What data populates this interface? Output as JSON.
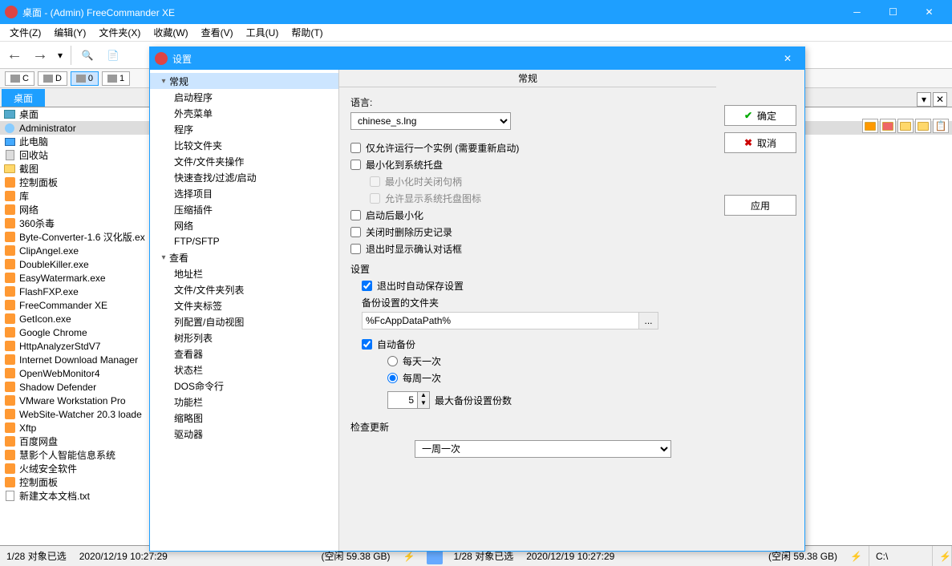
{
  "window": {
    "title": "桌面 - (Admin) FreeCommander XE"
  },
  "menu": [
    "文件(Z)",
    "编辑(Y)",
    "文件夹(X)",
    "收藏(W)",
    "查看(V)",
    "工具(U)",
    "帮助(T)"
  ],
  "drives": [
    {
      "label": "C"
    },
    {
      "label": "D"
    },
    {
      "label": "0",
      "active": true
    },
    {
      "label": "1"
    }
  ],
  "tab": {
    "label": "桌面"
  },
  "files": [
    {
      "name": "桌面",
      "icon": "desktop"
    },
    {
      "name": "Administrator",
      "icon": "user",
      "selected": true
    },
    {
      "name": "此电脑",
      "icon": "pc"
    },
    {
      "name": "回收站",
      "icon": "recycle"
    },
    {
      "name": "截图",
      "icon": "folder"
    },
    {
      "name": "控制面板",
      "icon": "control"
    },
    {
      "name": "库",
      "icon": "library"
    },
    {
      "name": "网络",
      "icon": "network"
    },
    {
      "name": "360杀毒",
      "icon": "app"
    },
    {
      "name": "Byte-Converter-1.6 汉化版.ex",
      "icon": "app"
    },
    {
      "name": "ClipAngel.exe",
      "icon": "app"
    },
    {
      "name": "DoubleKiller.exe",
      "icon": "app"
    },
    {
      "name": "EasyWatermark.exe",
      "icon": "app"
    },
    {
      "name": "FlashFXP.exe",
      "icon": "app"
    },
    {
      "name": "FreeCommander XE",
      "icon": "app"
    },
    {
      "name": "GetIcon.exe",
      "icon": "app"
    },
    {
      "name": "Google Chrome",
      "icon": "chrome"
    },
    {
      "name": "HttpAnalyzerStdV7",
      "icon": "app"
    },
    {
      "name": "Internet Download Manager",
      "icon": "app"
    },
    {
      "name": "OpenWebMonitor4",
      "icon": "app"
    },
    {
      "name": "Shadow Defender",
      "icon": "app"
    },
    {
      "name": "VMware Workstation Pro",
      "icon": "app"
    },
    {
      "name": "WebSite-Watcher 20.3 loade",
      "icon": "app"
    },
    {
      "name": "Xftp",
      "icon": "app"
    },
    {
      "name": "百度网盘",
      "icon": "app"
    },
    {
      "name": "慧影个人智能信息系统",
      "icon": "app"
    },
    {
      "name": "火绒安全软件",
      "icon": "app"
    },
    {
      "name": "控制面板",
      "icon": "control"
    },
    {
      "name": "新建文本文档.txt",
      "icon": "txt"
    }
  ],
  "status": {
    "left": {
      "selection": "1/28 对象已选",
      "date": "2020/12/19 10:27:29",
      "free": "(空闲 59.38 GB)"
    },
    "right": {
      "selection": "1/28 对象已选",
      "date": "2020/12/19 10:27:29",
      "free": "(空闲 59.38 GB)"
    },
    "path": "C:\\"
  },
  "dialog": {
    "title": "设置",
    "tree": [
      {
        "label": "常规",
        "level": 0,
        "expanded": true,
        "selected": true
      },
      {
        "label": "启动程序",
        "level": 1
      },
      {
        "label": "外壳菜单",
        "level": 1
      },
      {
        "label": "程序",
        "level": 1
      },
      {
        "label": "比较文件夹",
        "level": 1
      },
      {
        "label": "文件/文件夹操作",
        "level": 1
      },
      {
        "label": "快速查找/过滤/启动",
        "level": 1
      },
      {
        "label": "选择项目",
        "level": 1
      },
      {
        "label": "压缩插件",
        "level": 1
      },
      {
        "label": "网络",
        "level": 1
      },
      {
        "label": "FTP/SFTP",
        "level": 1
      },
      {
        "label": "查看",
        "level": 0,
        "expanded": true
      },
      {
        "label": "地址栏",
        "level": 1
      },
      {
        "label": "文件/文件夹列表",
        "level": 1
      },
      {
        "label": "文件夹标签",
        "level": 1
      },
      {
        "label": "列配置/自动视图",
        "level": 1
      },
      {
        "label": "树形列表",
        "level": 1
      },
      {
        "label": "查看器",
        "level": 1
      },
      {
        "label": "状态栏",
        "level": 1
      },
      {
        "label": "DOS命令行",
        "level": 1
      },
      {
        "label": "功能栏",
        "level": 1
      },
      {
        "label": "缩略图",
        "level": 1
      },
      {
        "label": "驱动器",
        "level": 1
      }
    ],
    "content": {
      "header": "常规",
      "language_label": "语言:",
      "language_value": "chinese_s.lng",
      "chk_single_instance": "仅允许运行一个实例 (需要重新启动)",
      "chk_minimize_tray": "最小化到系统托盘",
      "chk_close_handle": "最小化时关闭句柄",
      "chk_allow_tray_icon": "允许显示系统托盘图标",
      "chk_start_minimized": "启动后最小化",
      "chk_clear_history": "关闭时删除历史记录",
      "chk_confirm_exit": "退出时显示确认对话框",
      "section_settings": "设置",
      "chk_autosave": "退出时自动保存设置",
      "backup_folder_label": "备份设置的文件夹",
      "backup_folder_value": "%FcAppDataPath%",
      "chk_autobackup": "自动备份",
      "radio_daily": "每天一次",
      "radio_weekly": "每周一次",
      "max_backups_value": "5",
      "max_backups_label": "最大备份设置份数",
      "section_updates": "检查更新",
      "updates_value": "一周一次"
    },
    "buttons": {
      "ok": "确定",
      "cancel": "取消",
      "apply": "应用"
    }
  }
}
